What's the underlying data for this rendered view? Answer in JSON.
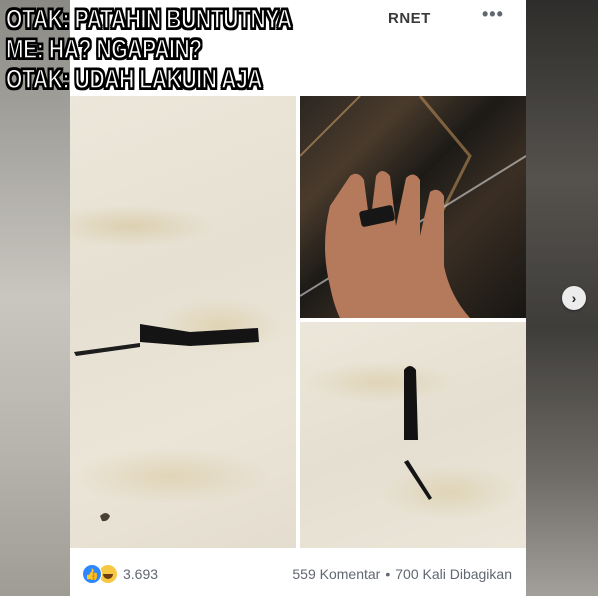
{
  "meme": {
    "line1": "OTAK: PATAHIN BUNTUTNYA",
    "line2": "ME: HA? NGAPAIN?",
    "line3": "OTAK: UDAH LAKUIN AJA"
  },
  "post": {
    "header_source": "RNET",
    "more_icon": "more-horizontal-icon",
    "header_sub": "..."
  },
  "footer": {
    "reaction_icons": [
      "like-icon",
      "haha-icon"
    ],
    "reaction_count": "3.693",
    "comments": "559 Komentar",
    "separator": "•",
    "shares": "700 Kali Dibagikan"
  },
  "carousel": {
    "next_icon": "chevron-right-icon",
    "next_glyph": "›"
  },
  "colors": {
    "like_blue": "#2d88ff",
    "haha_yellow": "#f7c843",
    "meta_gray": "#606770"
  }
}
